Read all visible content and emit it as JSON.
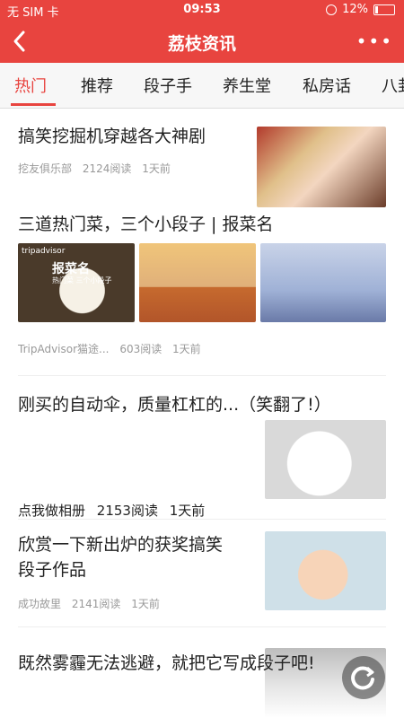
{
  "status_bar": {
    "carrier": "无 SIM 卡",
    "time": "09:53",
    "battery": "12%"
  },
  "navbar": {
    "title": "荔枝资讯",
    "back_icon": "chevron-left-icon",
    "more_icon": "more-dots-icon",
    "more_label": "•••"
  },
  "tabs": [
    {
      "label": "热门",
      "active": true
    },
    {
      "label": "推荐"
    },
    {
      "label": "段子手"
    },
    {
      "label": "养生堂"
    },
    {
      "label": "私房话"
    },
    {
      "label": "八卦"
    }
  ],
  "articles": [
    {
      "title": "搞笑挖掘机穿越各大神剧",
      "source": "挖友俱乐部",
      "reads": "2124阅读",
      "time": "1天前",
      "image": "drama-photo"
    },
    {
      "title": "三道热门菜，三个小段子 | 报菜名",
      "source": "TripAdvisor猫途...",
      "reads": "603阅读",
      "time": "1天前",
      "images": [
        "food-photo",
        "cartoon-pizza",
        "cartoon-couch"
      ],
      "overlay_text": [
        "tripadvisor",
        "报菜名",
        "热门菜 三个小段子"
      ]
    },
    {
      "title": "刚买的自动伞，质量杠杠的...（笑翻了!）",
      "source": "点我做相册",
      "reads": "2153阅读",
      "time": "1天前",
      "image": "cat-photo"
    },
    {
      "title_line1": "欣赏一下新出炉的获奖搞笑",
      "title_line2": "段子作品",
      "source": "成功故里",
      "reads": "2141阅读",
      "time": "1天前",
      "image": "girl-photo"
    },
    {
      "title": "既然雾霾无法逃避，就把它写成段子吧!",
      "image": "fog-photo"
    }
  ],
  "refresh_icon": "refresh-icon",
  "colors": {
    "brand": "#e8443f",
    "meta": "#999999"
  }
}
